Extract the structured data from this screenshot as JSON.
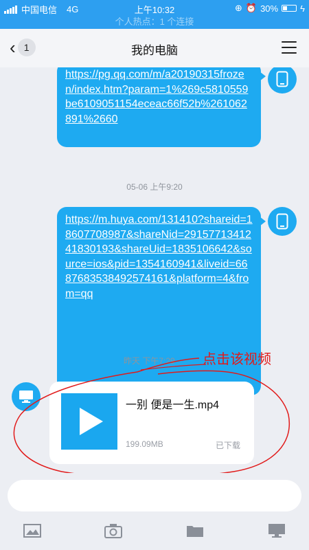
{
  "status_bar": {
    "carrier": "中国电信",
    "network": "4G",
    "time": "上午10:32",
    "battery": "30%"
  },
  "banner": {
    "text": "个人热点：1 个连接"
  },
  "nav": {
    "back_count": "1",
    "title": "我的电脑"
  },
  "messages": [
    {
      "text": "https://pg.qq.com/m/a20190315frozen/index.htm?param=1%269c5810559be6109051154eceac66f52b%261062891%2660"
    },
    {
      "timestamp": "05-06 上午9:20",
      "text": "https://m.huya.com/131410?shareid=18607708987&shareNid=2915771341241830193&shareUid=1835106642&source=ios&pid=1354160941&liveid=6687683538492574161&platform=4&from=qq"
    }
  ],
  "file_message": {
    "timestamp": "昨天 下午7:29",
    "file_name": "一别 便是一生.mp4",
    "file_size": "199.09MB",
    "status": "已下载"
  },
  "annotation": {
    "text": "点击该视频",
    "color": "#e11a1a"
  },
  "input": {
    "placeholder": ""
  },
  "toolbar": {
    "icons": [
      "image-icon",
      "camera-icon",
      "folder-icon",
      "computer-icon"
    ]
  },
  "colors": {
    "accent": "#1eaaf1",
    "status_bar": "#2d9ff0",
    "background": "#eceef3"
  }
}
